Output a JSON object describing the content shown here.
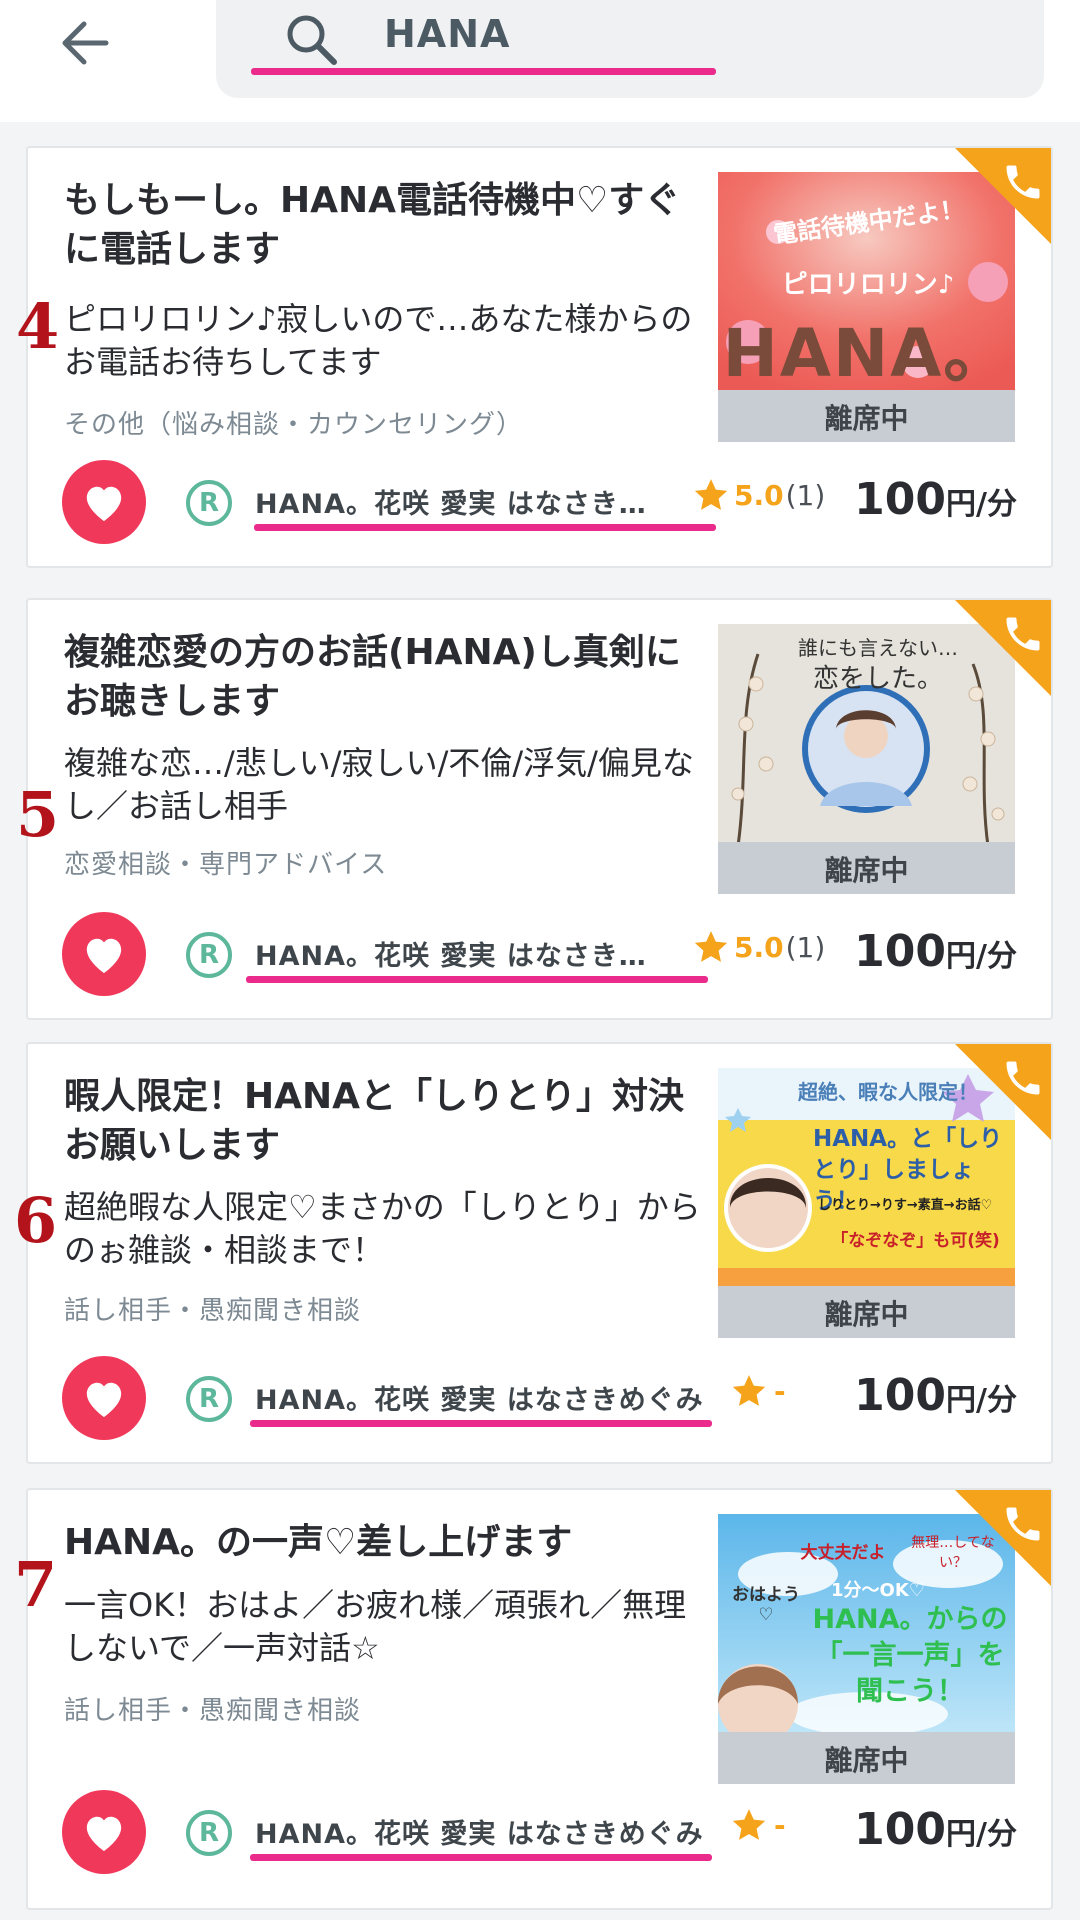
{
  "search": {
    "query": "HANA"
  },
  "status_label": "離席中",
  "cards": [
    {
      "rank": "4",
      "title": "もしもーし。HANA電話待機中♡すぐに電話します",
      "description": "ピロリロリン♪寂しいので…あなた様からのお電話お待ちしてます",
      "category": "その他（悩み相談・カウンセリング）",
      "host": "HANA。花咲 愛実 はなさき…",
      "score": "5.0",
      "count": "(1)",
      "price_num": "100",
      "price_unit": "円/分",
      "thumb_text_1": "電話待機中だよ！",
      "thumb_text_2": "ピロリロリン♪",
      "thumb_text_3": "HANA。"
    },
    {
      "rank": "5",
      "title": "複雑恋愛の方のお話(HANA)し真剣にお聴きします",
      "description": "複雑な恋…/悲しい/寂しい/不倫/浮気/偏見なし／お話し相手",
      "category": "恋愛相談・専門アドバイス",
      "host": "HANA。花咲 愛実 はなさき…",
      "score": "5.0",
      "count": "(1)",
      "price_num": "100",
      "price_unit": "円/分",
      "thumb_text_1": "誰にも言えない…",
      "thumb_text_2": "恋をした。"
    },
    {
      "rank": "6",
      "title": "暇人限定！HANAと「しりとり」対決お願いします",
      "description": "超絶暇な人限定♡まさかの「しりとり」からのぉ雑談・相談まで！",
      "category": "話し相手・愚痴聞き相談",
      "host": "HANA。花咲 愛実 はなさきめぐみ",
      "score_dash": "-",
      "price_num": "100",
      "price_unit": "円/分",
      "thumb_text_1": "超絶、暇な人限定！",
      "thumb_text_2": "HANA。と「しりとり」しましょう！",
      "thumb_text_3": "しりとり→りす→素直→お話♡",
      "thumb_text_4": "「なぞなぞ」も可(笑)"
    },
    {
      "rank": "7",
      "title": "HANA。の一声♡差し上げます",
      "description": "一言OK！おはよ／お疲れ様／頑張れ／無理しないで／一声対話☆",
      "category": "話し相手・愚痴聞き相談",
      "host": "HANA。花咲 愛実 はなさきめぐみ",
      "score_dash": "-",
      "price_num": "100",
      "price_unit": "円/分",
      "thumb_text_1": "大丈夫だよ",
      "thumb_text_2": "無理…してない？",
      "thumb_text_3": "おはよう♡",
      "thumb_text_4": "1分〜OK♡",
      "thumb_text_5": "HANA。からの「一言一声」を聞こう！"
    }
  ],
  "colors": {
    "accent_pink": "#ea2b8c",
    "favorite_red": "#f0395a",
    "star_orange": "#f5a31a",
    "badge_green": "#5db79b",
    "rank_red": "#b3131b"
  }
}
